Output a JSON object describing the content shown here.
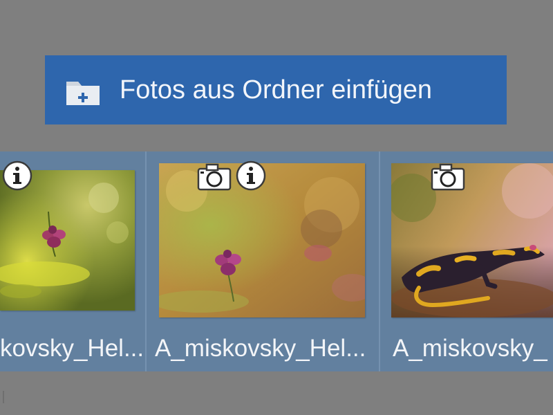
{
  "toolbar": {
    "add_folder_label": "Fotos aus Ordner einfügen",
    "add_folder_icon": "folder-plus-icon"
  },
  "photos": [
    {
      "caption": "kovsky_Hel...",
      "badges": [
        "info-icon"
      ]
    },
    {
      "caption": "A_miskovsky_Hel...",
      "badges": [
        "camera-icon",
        "info-icon"
      ]
    },
    {
      "caption": "A_miskovsky_",
      "badges": [
        "camera-icon"
      ]
    }
  ],
  "colors": {
    "background": "#7f7f7f",
    "button": "#2e66ad",
    "strip": "#62809f",
    "caption_text": "#f3f5f8"
  }
}
